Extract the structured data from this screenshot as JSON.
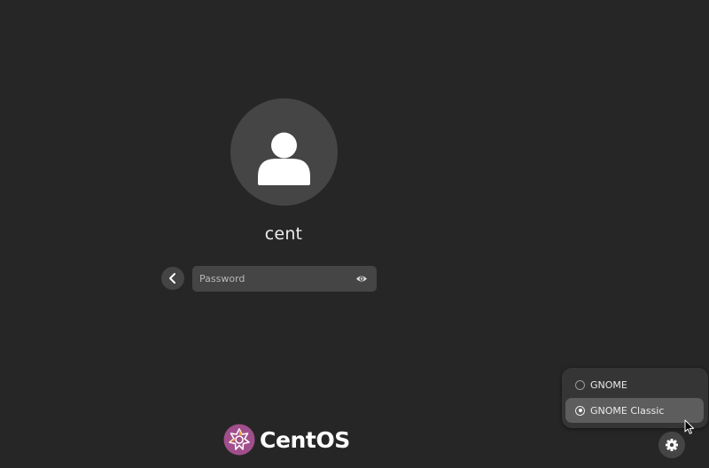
{
  "login": {
    "username": "cent",
    "password_placeholder": "Password"
  },
  "branding": {
    "logo_text": "CentOS",
    "logo_icon": "centos-logo-icon",
    "accent_color": "#a14f8c"
  },
  "session_menu": {
    "items": [
      {
        "label": "GNOME",
        "selected": false
      },
      {
        "label": "GNOME Classic",
        "selected": true
      }
    ]
  },
  "icons": {
    "avatar": "user-avatar-icon",
    "back": "chevron-left-icon",
    "reveal_password": "eye-icon",
    "settings": "gear-icon",
    "cursor": "mouse-pointer-icon"
  }
}
